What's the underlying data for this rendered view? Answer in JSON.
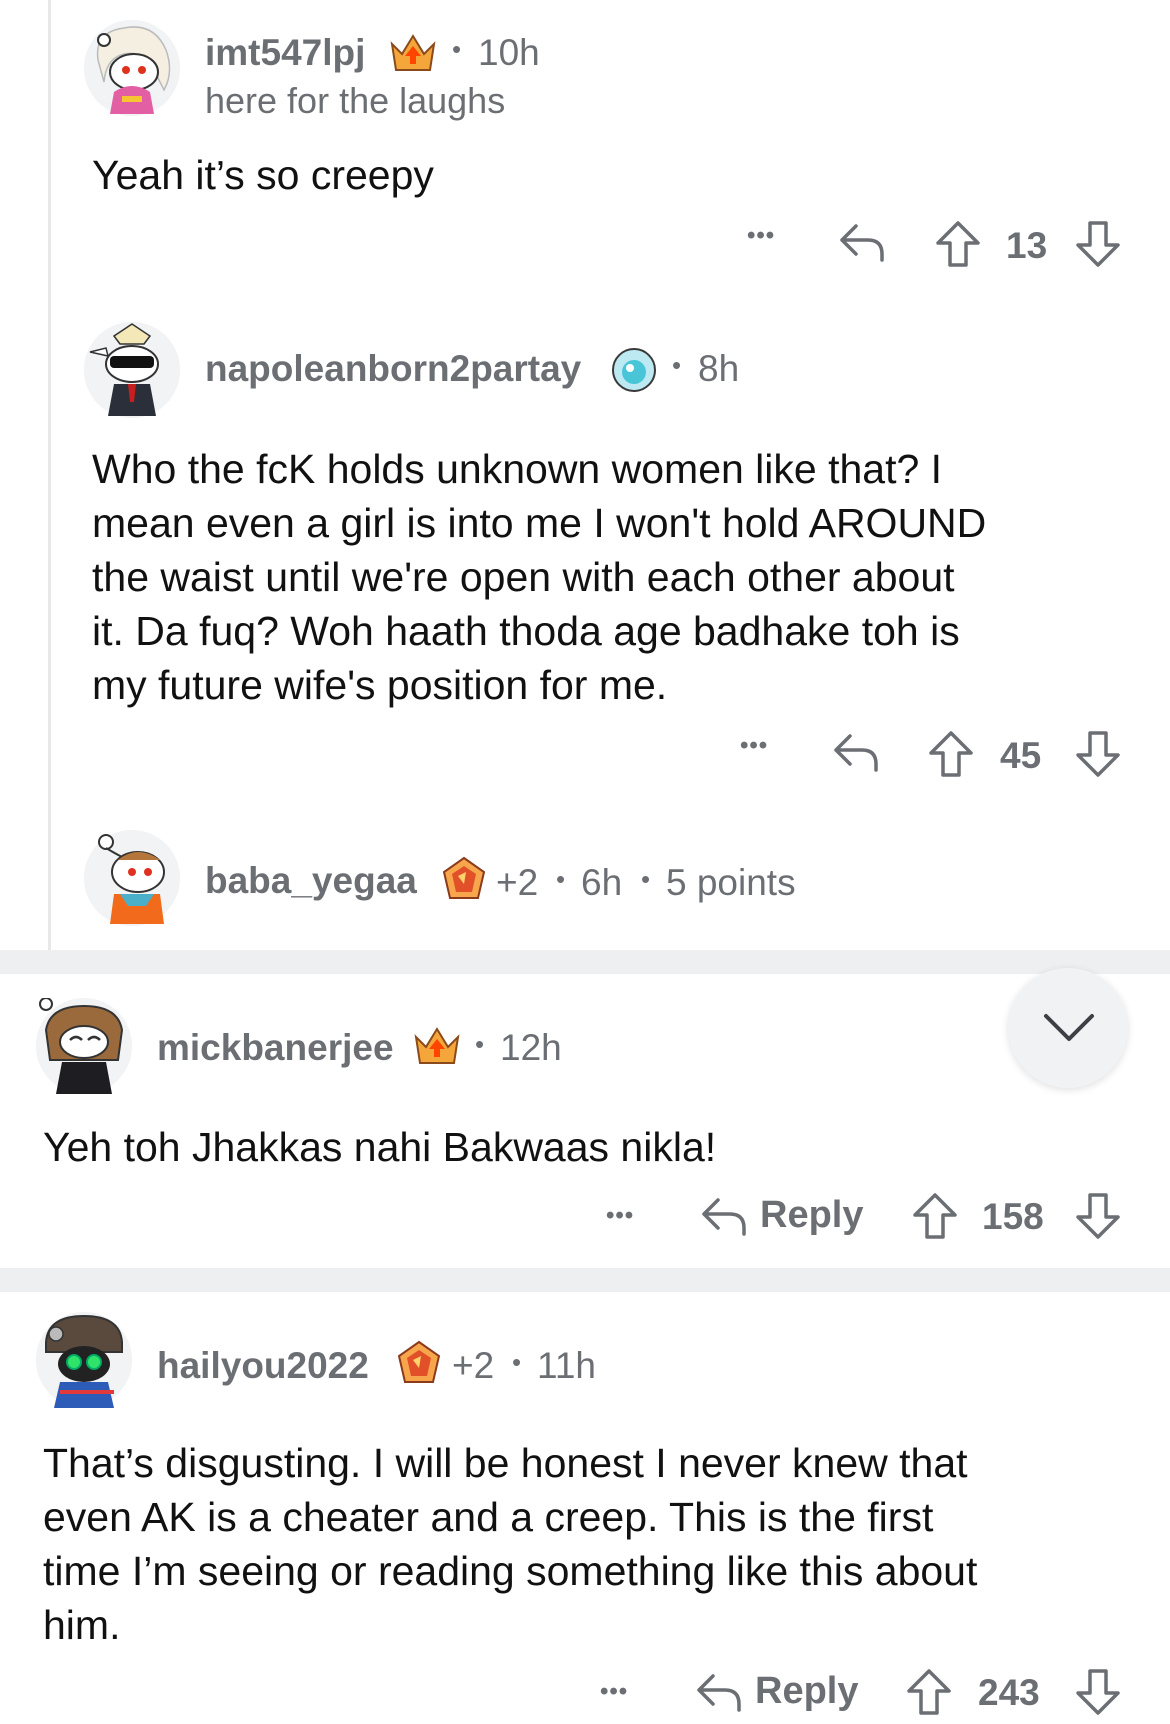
{
  "comments": [
    {
      "username": "imt547lpj",
      "age": "10h",
      "flair": "here for the laughs",
      "body": [
        "Yeah it’s so creepy"
      ],
      "score": "13",
      "award_icon": "crown-upvote-award-icon"
    },
    {
      "username": "napoleanborn2partay",
      "age": "8h",
      "body": [
        "Who the fcK holds unknown women like that? I",
        "mean even a girl is into me I won't hold AROUND",
        "the waist until we're open with each other about",
        "it. Da fuq? Woh haath thoda age badhake toh is",
        "my future wife's position for me."
      ],
      "score": "45",
      "award_icon": "snoo-orb-award-icon"
    },
    {
      "username": "baba_yegaa",
      "award_count": "+2",
      "age": "6h",
      "points": "5 points",
      "award_icon": "gem-award-icon"
    },
    {
      "username": "mickbanerjee",
      "age": "12h",
      "body": [
        "Yeh toh Jhakkas nahi Bakwaas nikla!"
      ],
      "reply_label": "Reply",
      "score": "158",
      "award_icon": "crown-upvote-award-icon"
    },
    {
      "username": "hailyou2022",
      "award_count": "+2",
      "age": "11h",
      "body": [
        "That’s disgusting. I will be honest I never knew that",
        "even AK is a cheater and a creep. This is the first",
        "time I’m seeing or reading something like this about",
        "him."
      ],
      "reply_label": "Reply",
      "score": "243",
      "award_icon": "gem-award-icon"
    }
  ],
  "common": {
    "dot_sep": "•",
    "more": "•••"
  },
  "colors": {
    "meta_gray": "#6b6f74",
    "separator": "#edeff1",
    "text": "#111111"
  }
}
